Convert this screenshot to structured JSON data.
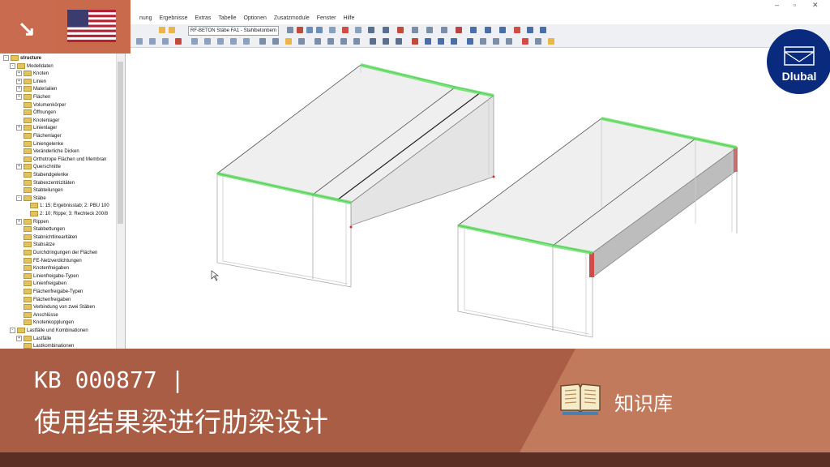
{
  "menu": {
    "items": [
      "nung",
      "Ergebnisse",
      "Extras",
      "Tabelle",
      "Optionen",
      "Zusatzmodule",
      "Fenster",
      "Hilfe"
    ]
  },
  "toolbar": {
    "combo_value": "RF-BETON Stäbe FA1 - Stahlbetonbem"
  },
  "tree": {
    "rows": [
      {
        "label": "structure",
        "level": 0,
        "exp": "-"
      },
      {
        "label": "Modelldaten",
        "level": 1,
        "exp": "-"
      },
      {
        "label": "Knoten",
        "level": 2,
        "exp": "+"
      },
      {
        "label": "Linien",
        "level": 2,
        "exp": "+"
      },
      {
        "label": "Materialien",
        "level": 2,
        "exp": "+"
      },
      {
        "label": "Flächen",
        "level": 2,
        "exp": "+"
      },
      {
        "label": "Volumenkörper",
        "level": 2,
        "exp": ""
      },
      {
        "label": "Öffnungen",
        "level": 2,
        "exp": ""
      },
      {
        "label": "Knotenlager",
        "level": 2,
        "exp": ""
      },
      {
        "label": "Linienlager",
        "level": 2,
        "exp": "+"
      },
      {
        "label": "Flächenlager",
        "level": 2,
        "exp": ""
      },
      {
        "label": "Liniengelenke",
        "level": 2,
        "exp": ""
      },
      {
        "label": "Veränderliche Dicken",
        "level": 2,
        "exp": ""
      },
      {
        "label": "Orthotrope Flächen und Membran",
        "level": 2,
        "exp": ""
      },
      {
        "label": "Querschnitte",
        "level": 2,
        "exp": "+"
      },
      {
        "label": "Stabendgelenke",
        "level": 2,
        "exp": ""
      },
      {
        "label": "Stabexzentrizitäten",
        "level": 2,
        "exp": ""
      },
      {
        "label": "Stabteilungen",
        "level": 2,
        "exp": ""
      },
      {
        "label": "Stäbe",
        "level": 2,
        "exp": "-"
      },
      {
        "label": "1: 15; Ergebnisstab; 2: PBU 100",
        "level": 3,
        "exp": ""
      },
      {
        "label": "2: 10; Rippe; 3: Rechteck 200/8",
        "level": 3,
        "exp": ""
      },
      {
        "label": "Rippen",
        "level": 2,
        "exp": "+"
      },
      {
        "label": "Stabbettungen",
        "level": 2,
        "exp": ""
      },
      {
        "label": "Stabnichtlinearitäten",
        "level": 2,
        "exp": ""
      },
      {
        "label": "Stabsätze",
        "level": 2,
        "exp": ""
      },
      {
        "label": "Durchdringungen der Flächen",
        "level": 2,
        "exp": ""
      },
      {
        "label": "FE-Netzverdichtungen",
        "level": 2,
        "exp": ""
      },
      {
        "label": "Knotenfreigaben",
        "level": 2,
        "exp": ""
      },
      {
        "label": "Linienfreigabe-Typen",
        "level": 2,
        "exp": ""
      },
      {
        "label": "Linienfreigaben",
        "level": 2,
        "exp": ""
      },
      {
        "label": "Flächenfreigabe-Typen",
        "level": 2,
        "exp": ""
      },
      {
        "label": "Flächenfreigaben",
        "level": 2,
        "exp": ""
      },
      {
        "label": "Verbindung von zwei Stäben",
        "level": 2,
        "exp": ""
      },
      {
        "label": "Anschlüsse",
        "level": 2,
        "exp": ""
      },
      {
        "label": "Knotenkopplungen",
        "level": 2,
        "exp": ""
      },
      {
        "label": "Lastfälle und Kombinationen",
        "level": 1,
        "exp": "-"
      },
      {
        "label": "Lastfälle",
        "level": 2,
        "exp": "+"
      },
      {
        "label": "Lastkombinationen",
        "level": 2,
        "exp": ""
      }
    ]
  },
  "logo": {
    "text": "Dlubal"
  },
  "banner": {
    "code": "KB 000877 |",
    "title": "使用结果梁进行肋梁设计",
    "category": "知识库"
  },
  "colors": {
    "accent": "#c86b4e",
    "banner": "#a95d45",
    "band": "#5b2f24",
    "logo": "#0a2b7d",
    "highlight": "#5ee05e"
  }
}
